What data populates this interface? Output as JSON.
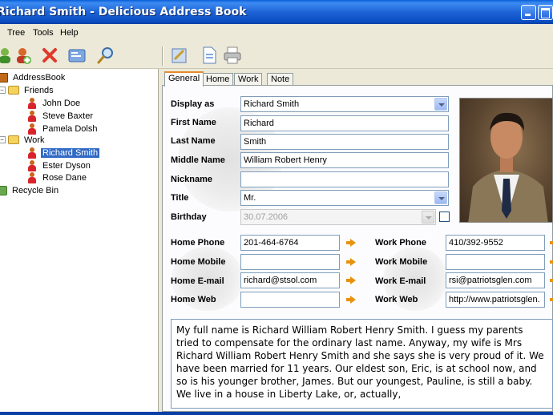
{
  "window": {
    "title": "Richard Smith - Delicious Address Book"
  },
  "menu": [
    "Tree",
    "Tools",
    "Help"
  ],
  "toolbar": {
    "buttons": [
      "add-contact-icon",
      "add-group-icon",
      "delete-icon",
      "card-icon",
      "search-icon",
      "edit-icon",
      "page-icon",
      "print-icon"
    ]
  },
  "tree": {
    "root": "AddressBook",
    "groups": [
      {
        "name": "Friends",
        "items": [
          "John Doe",
          "Steve Baxter",
          "Pamela Dolsh"
        ]
      },
      {
        "name": "Work",
        "items": [
          "Richard Smith",
          "Ester Dyson",
          "Rose Dane"
        ]
      }
    ],
    "recycle": "Recycle Bin",
    "selected": "Richard Smith"
  },
  "tabs": [
    "General",
    "Home",
    "Work",
    "Note"
  ],
  "form": {
    "display_as": {
      "label": "Display as",
      "value": "Richard Smith"
    },
    "first_name": {
      "label": "First Name",
      "value": "Richard"
    },
    "last_name": {
      "label": "Last Name",
      "value": "Smith"
    },
    "middle_name": {
      "label": "Middle Name",
      "value": "William Robert Henry"
    },
    "nickname": {
      "label": "Nickname",
      "value": ""
    },
    "title": {
      "label": "Title",
      "value": "Mr."
    },
    "birthday": {
      "label": "Birthday",
      "value": "30.07.2006"
    }
  },
  "contacts": {
    "home_phone": {
      "label": "Home Phone",
      "value": "201-464-6764"
    },
    "home_mobile": {
      "label": "Home Mobile",
      "value": ""
    },
    "home_email": {
      "label": "Home E-mail",
      "value": "richard@stsol.com"
    },
    "home_web": {
      "label": "Home Web",
      "value": ""
    },
    "work_phone": {
      "label": "Work Phone",
      "value": "410/392-9552"
    },
    "work_mobile": {
      "label": "Work Mobile",
      "value": ""
    },
    "work_email": {
      "label": "Work E-mail",
      "value": "rsi@patriotsglen.com"
    },
    "work_web": {
      "label": "Work Web",
      "value": "http://www.patriotsglen."
    }
  },
  "notes": "My full name is Richard William Robert Henry Smith. I guess my parents tried to compensate for the ordinary last name. Anyway, my wife is Mrs Richard William Robert Henry Smith and she says she is very proud of it. We have been married for 11 years. Our eldest son, Eric, is at school now, and so is his younger brother, James. But our youngest, Pauline, is still a baby. We live in a house in Liberty Lake, or, actually,"
}
